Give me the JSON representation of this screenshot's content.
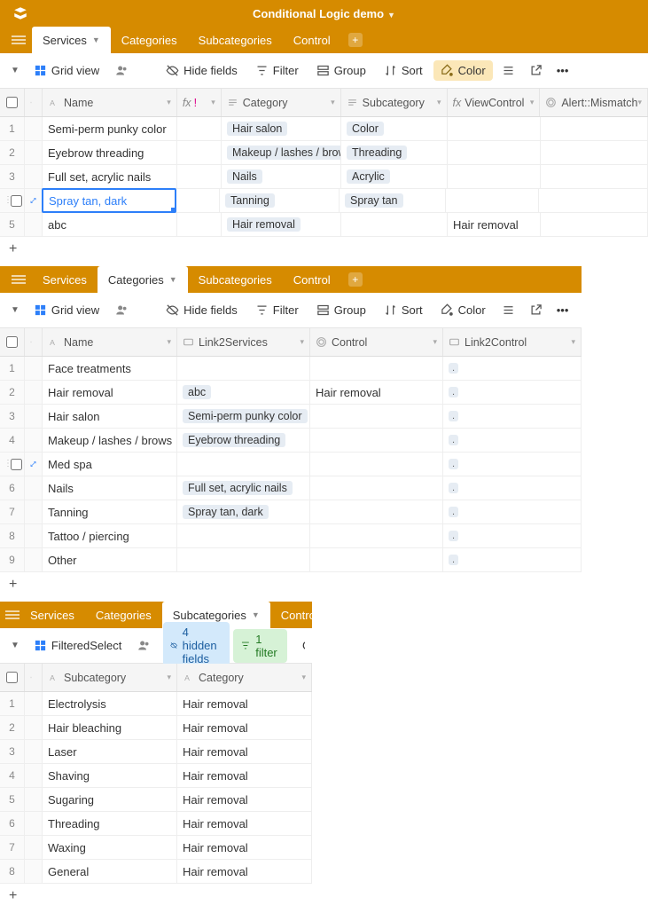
{
  "header": {
    "title": "Conditional Logic demo"
  },
  "tabs": {
    "services": "Services",
    "categories": "Categories",
    "subcategories": "Subcategories",
    "control": "Control"
  },
  "toolbar": {
    "grid_view": "Grid view",
    "filtered_select": "FilteredSelect",
    "hide_fields": "Hide fields",
    "hidden_fields": "4 hidden fields",
    "filter": "Filter",
    "one_filter": "1 filter",
    "group": "Group",
    "sort": "Sort",
    "color": "Color",
    "gro": "Gro"
  },
  "cols": {
    "name": "Name",
    "category": "Category",
    "subcategory": "Subcategory",
    "viewcontrol": "ViewControl",
    "alert": "Alert::Mismatch",
    "link2services": "Link2Services",
    "control": "Control",
    "link2control": "Link2Control"
  },
  "services": {
    "rows": [
      {
        "n": "1",
        "name": "Semi-perm punky color",
        "cat": "Hair salon",
        "sub": "Color",
        "vc": "",
        "alert": ""
      },
      {
        "n": "2",
        "name": "Eyebrow threading",
        "cat": "Makeup / lashes / brows",
        "sub": "Threading",
        "vc": "",
        "alert": ""
      },
      {
        "n": "3",
        "name": "Full set, acrylic nails",
        "cat": "Nails",
        "sub": "Acrylic",
        "vc": "",
        "alert": ""
      },
      {
        "n": "4",
        "name": "Spray tan, dark",
        "cat": "Tanning",
        "sub": "Spray tan",
        "vc": "",
        "alert": "",
        "editing": true
      },
      {
        "n": "5",
        "name": "abc",
        "cat": "Hair removal",
        "sub": "",
        "vc": "Hair removal",
        "alert": ""
      }
    ]
  },
  "categories": {
    "rows": [
      {
        "n": "1",
        "name": "Face treatments",
        "l2s": "",
        "ctrl": "",
        "l2c": "."
      },
      {
        "n": "2",
        "name": "Hair removal",
        "l2s": "abc",
        "ctrl": "Hair removal",
        "l2c": "."
      },
      {
        "n": "3",
        "name": "Hair salon",
        "l2s": "Semi-perm punky color",
        "ctrl": "",
        "l2c": "."
      },
      {
        "n": "4",
        "name": "Makeup / lashes / brows",
        "l2s": "Eyebrow threading",
        "ctrl": "",
        "l2c": "."
      },
      {
        "n": "5",
        "name": "Med spa",
        "l2s": "",
        "ctrl": "",
        "l2c": ".",
        "sel": true
      },
      {
        "n": "6",
        "name": "Nails",
        "l2s": "Full set, acrylic nails",
        "ctrl": "",
        "l2c": "."
      },
      {
        "n": "7",
        "name": "Tanning",
        "l2s": "Spray tan, dark",
        "ctrl": "",
        "l2c": "."
      },
      {
        "n": "8",
        "name": "Tattoo / piercing",
        "l2s": "",
        "ctrl": "",
        "l2c": "."
      },
      {
        "n": "9",
        "name": "Other",
        "l2s": "",
        "ctrl": "",
        "l2c": "."
      }
    ]
  },
  "subcategories": {
    "rows": [
      {
        "n": "1",
        "sub": "Electrolysis",
        "cat": "Hair removal"
      },
      {
        "n": "2",
        "sub": "Hair bleaching",
        "cat": "Hair removal"
      },
      {
        "n": "3",
        "sub": "Laser",
        "cat": "Hair removal"
      },
      {
        "n": "4",
        "sub": "Shaving",
        "cat": "Hair removal"
      },
      {
        "n": "5",
        "sub": "Sugaring",
        "cat": "Hair removal"
      },
      {
        "n": "6",
        "sub": "Threading",
        "cat": "Hair removal"
      },
      {
        "n": "7",
        "sub": "Waxing",
        "cat": "Hair removal"
      },
      {
        "n": "8",
        "sub": "General",
        "cat": "Hair removal"
      }
    ]
  }
}
